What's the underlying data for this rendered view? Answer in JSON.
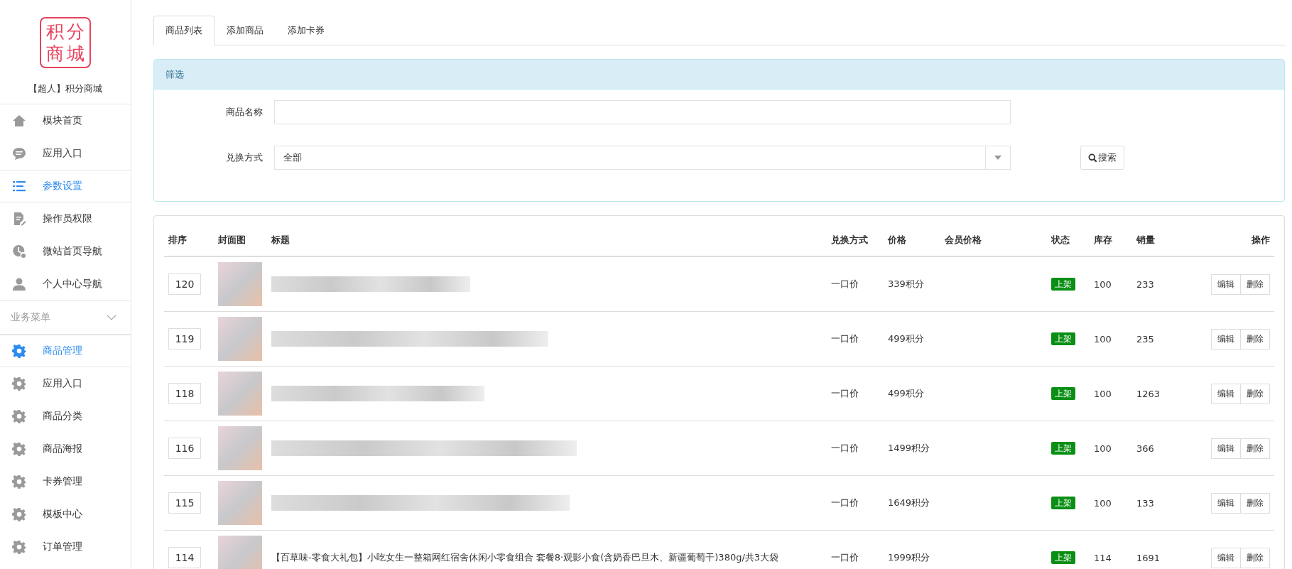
{
  "sidebar": {
    "logo_lines": [
      "积分",
      "商城"
    ],
    "title": "【超人】积分商城",
    "menu": [
      {
        "label": "模块首页",
        "kind": "home",
        "selected": false
      },
      {
        "label": "应用入口",
        "kind": "chat",
        "selected": false
      },
      {
        "label": "参数设置",
        "kind": "list",
        "selected": true
      },
      {
        "label": "操作员权限",
        "kind": "doc",
        "selected": false
      },
      {
        "label": "微站首页导航",
        "kind": "clock",
        "selected": false
      },
      {
        "label": "个人中心导航",
        "kind": "person",
        "selected": false
      }
    ],
    "section": {
      "label": "业务菜单",
      "expanded": true,
      "items": [
        {
          "label": "商品管理",
          "kind": "gear",
          "selected": true
        },
        {
          "label": "应用入口",
          "kind": "gear",
          "selected": false
        },
        {
          "label": "商品分类",
          "kind": "gear",
          "selected": false
        },
        {
          "label": "商品海报",
          "kind": "gear",
          "selected": false
        },
        {
          "label": "卡券管理",
          "kind": "gear",
          "selected": false
        },
        {
          "label": "模板中心",
          "kind": "gear",
          "selected": false
        },
        {
          "label": "订单管理",
          "kind": "gear",
          "selected": false
        }
      ]
    }
  },
  "tabs": [
    {
      "label": "商品列表",
      "selected": true
    },
    {
      "label": "添加商品",
      "selected": false
    },
    {
      "label": "添加卡券",
      "selected": false
    }
  ],
  "filter": {
    "title": "筛选",
    "name_label": "商品名称",
    "exchange_label": "兑换方式",
    "exchange_value": "全部",
    "search_button": "搜索"
  },
  "table": {
    "columns": [
      "排序",
      "封面图",
      "标题",
      "兑换方式",
      "价格",
      "会员价格",
      "状态",
      "库存",
      "销量",
      "操作"
    ],
    "rows": [
      {
        "sort": "120",
        "exchange": "一口价",
        "price": "339积分",
        "status": "上架",
        "stock": "100",
        "sales": "233",
        "actions": [
          "编辑",
          "删除"
        ]
      },
      {
        "sort": "119",
        "exchange": "一口价",
        "price": "499积分",
        "status": "上架",
        "stock": "100",
        "sales": "235",
        "actions": [
          "编辑",
          "删除"
        ]
      },
      {
        "sort": "118",
        "exchange": "一口价",
        "price": "499积分",
        "status": "上架",
        "stock": "100",
        "sales": "1263",
        "actions": [
          "编辑",
          "删除"
        ]
      },
      {
        "sort": "116",
        "exchange": "一口价",
        "price": "1499积分",
        "status": "上架",
        "stock": "100",
        "sales": "366",
        "actions": [
          "编辑",
          "删除"
        ]
      },
      {
        "sort": "115",
        "exchange": "一口价",
        "price": "1649积分",
        "status": "上架",
        "stock": "100",
        "sales": "133",
        "actions": [
          "编辑",
          "删除"
        ]
      },
      {
        "sort": "114",
        "title": "【百草味-零食大礼包】小吃女生一整箱网红宿舍休闲小零食组合 套餐8·观影小食(含奶香巴旦木、新疆葡萄干)380g/共3大袋",
        "exchange": "一口价",
        "price": "1999积分",
        "status": "上架",
        "stock": "114",
        "sales": "1691",
        "actions": [
          "编辑",
          "删除"
        ]
      }
    ]
  }
}
